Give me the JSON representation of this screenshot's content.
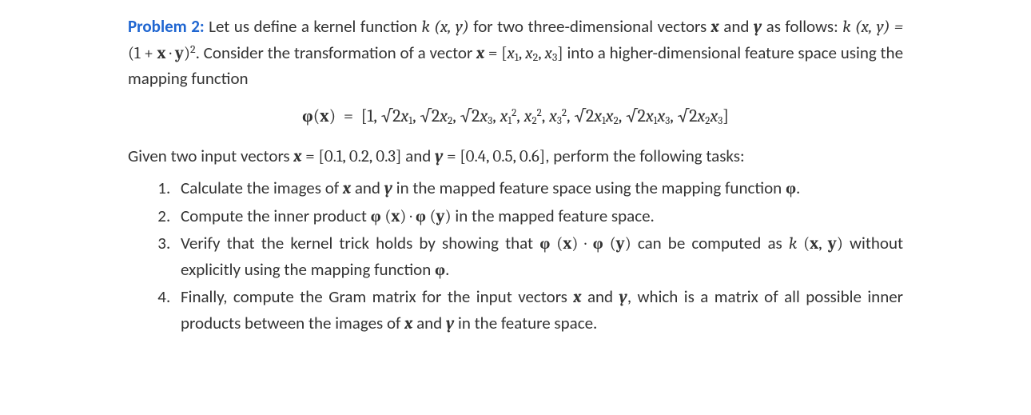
{
  "problem": {
    "label": "Problem 2:",
    "intro_part1": " Let us define a kernel function ",
    "k_xy": "k (x, y)",
    "intro_part2": " for two three-dimensional vectors ",
    "xb": "x",
    "and": " and ",
    "yb": "y",
    "intro_part3": " as follows: ",
    "k_def_lhs": "k (x, y)  =  ",
    "k_def_rhs": "(1 + x · y)²",
    "intro_part4": ". Consider the transformation of a vector ",
    "eq_x": "x  =  ",
    "x_vec": "[x₁, x₂, x₃]",
    "intro_part5": " into a higher-dimensional feature space using the mapping function"
  },
  "phi_formula": {
    "lhs": "φ(x)  =  ",
    "open": "[1, √2",
    "x1": "x",
    "s1": "1",
    "c1": ", √2",
    "x2": "x",
    "s2": "2",
    "c2": ", √2",
    "x3": "x",
    "s3": "3",
    "c3": ", ",
    "x4": "x",
    "s4a": "1",
    "s4b": "2",
    "c4": ", ",
    "x5": "x",
    "s5a": "2",
    "s5b": "2",
    "c5": ", ",
    "x6": "x",
    "s6a": "3",
    "s6b": "2",
    "c6": ", √2",
    "x7a": "x",
    "s7a": "1",
    "x7b": "x",
    "s7b": "2",
    "c7": ", √2",
    "x8a": "x",
    "s8a": "1",
    "x8b": "x",
    "s8b": "3",
    "c8": ", √2",
    "x9a": "x",
    "s9a": "2",
    "x9b": "x",
    "s9b": "3",
    "close": "]"
  },
  "given": {
    "part1": "Given two input vectors ",
    "xeq": "x  =  ",
    "xv": "[0.1, 0.2, 0.3]",
    "part2": " and ",
    "yeq": "y  =  ",
    "yv": "[0.4, 0.5, 0.6]",
    "part3": ", perform the following tasks:"
  },
  "tasks": {
    "t1a": "Calculate the images of ",
    "t1b": " and ",
    "t1c": " in the mapped feature space using the mapping function ",
    "phi": "φ",
    "dot": ".",
    "t2a": "Compute the inner product ",
    "phix": "φ (x)",
    "cdot": " · ",
    "phiy": "φ (y)",
    "t2b": " in the mapped feature space.",
    "t3a": "Verify that the kernel trick holds by showing that ",
    "t3b": "  can be computed as ",
    "kxy": "k (x, y)",
    "t3c": " without explicitly using the mapping function ",
    "t4a": "Finally, compute the Gram matrix for the input vectors ",
    "t4b": ", which is a matrix of all possible inner products between the images of ",
    "t4c": " in the feature space."
  }
}
